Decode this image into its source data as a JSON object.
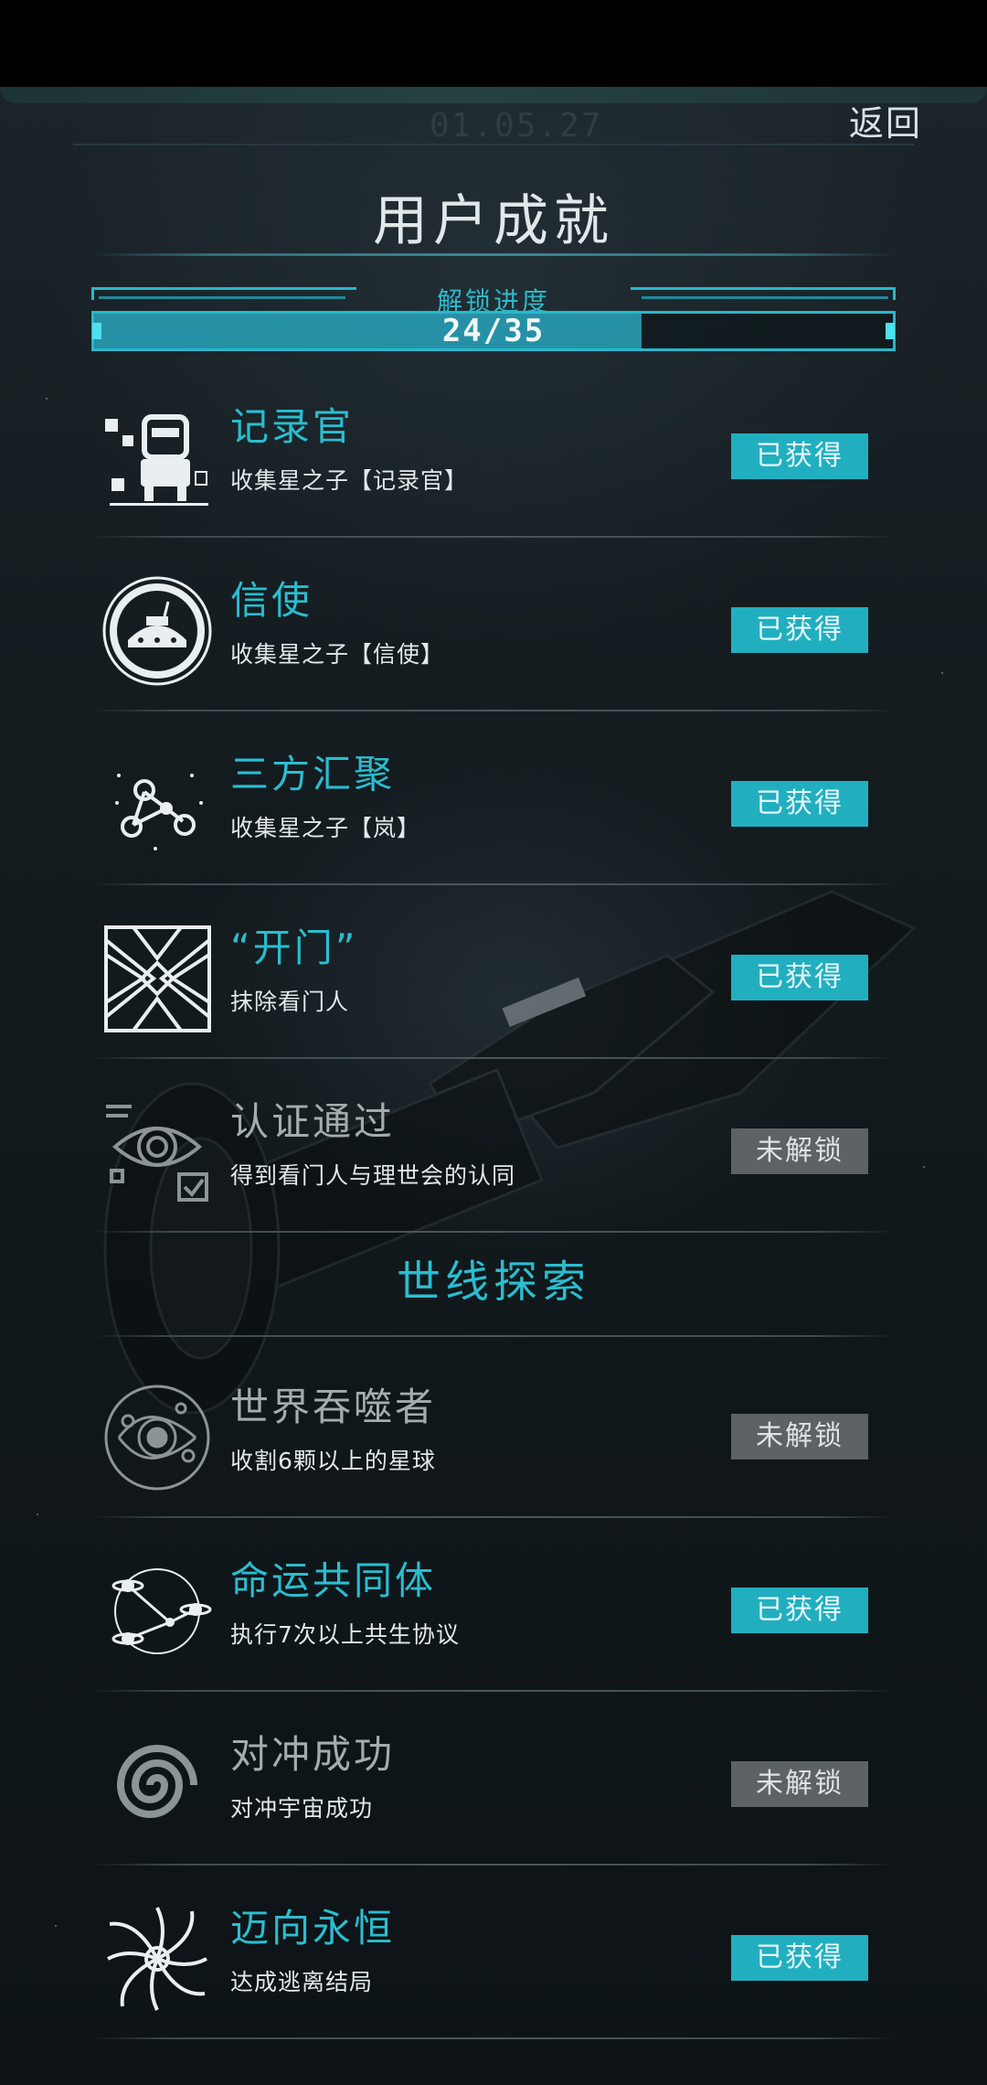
{
  "header": {
    "date": "01.05.27",
    "back_label": "返回",
    "title": "用户成就"
  },
  "progress": {
    "label": "解锁进度",
    "value_text": "24/35",
    "unlocked": 24,
    "total": 35
  },
  "colors": {
    "accent": "#2bbdd0",
    "unlocked_badge": "#21afc0",
    "locked_badge": "#5d6265",
    "locked_title": "#a5acae"
  },
  "achievements": [
    {
      "icon": "recorder-robot-icon",
      "title": "记录官",
      "desc": "收集星之子【记录官】",
      "status": "已获得",
      "unlocked": true
    },
    {
      "icon": "messenger-circle-icon",
      "title": "信使",
      "desc": "收集星之子【信使】",
      "status": "已获得",
      "unlocked": true
    },
    {
      "icon": "three-party-network-icon",
      "title": "三方汇聚",
      "desc": "收集星之子【岚】",
      "status": "已获得",
      "unlocked": true
    },
    {
      "icon": "open-gate-icon",
      "title": "“开门”",
      "desc": "抹除看门人",
      "status": "已获得",
      "unlocked": true
    },
    {
      "icon": "eye-verify-icon",
      "title": "认证通过",
      "desc": "得到看门人与理世会的认同",
      "status": "未解锁",
      "unlocked": false
    }
  ],
  "section": {
    "title": "世线探索"
  },
  "explore": [
    {
      "icon": "world-devourer-icon",
      "title": "世界吞噬者",
      "desc": "收割6颗以上的星球",
      "status": "未解锁",
      "unlocked": false
    },
    {
      "icon": "linked-planets-icon",
      "title": "命运共同体",
      "desc": "执行7次以上共生协议",
      "status": "已获得",
      "unlocked": true
    },
    {
      "icon": "spiral-vortex-icon",
      "title": "对冲成功",
      "desc": "对冲宇宙成功",
      "status": "未解锁",
      "unlocked": false
    },
    {
      "icon": "eternity-swirl-icon",
      "title": "迈向永恒",
      "desc": "达成逃离结局",
      "status": "已获得",
      "unlocked": true
    }
  ]
}
